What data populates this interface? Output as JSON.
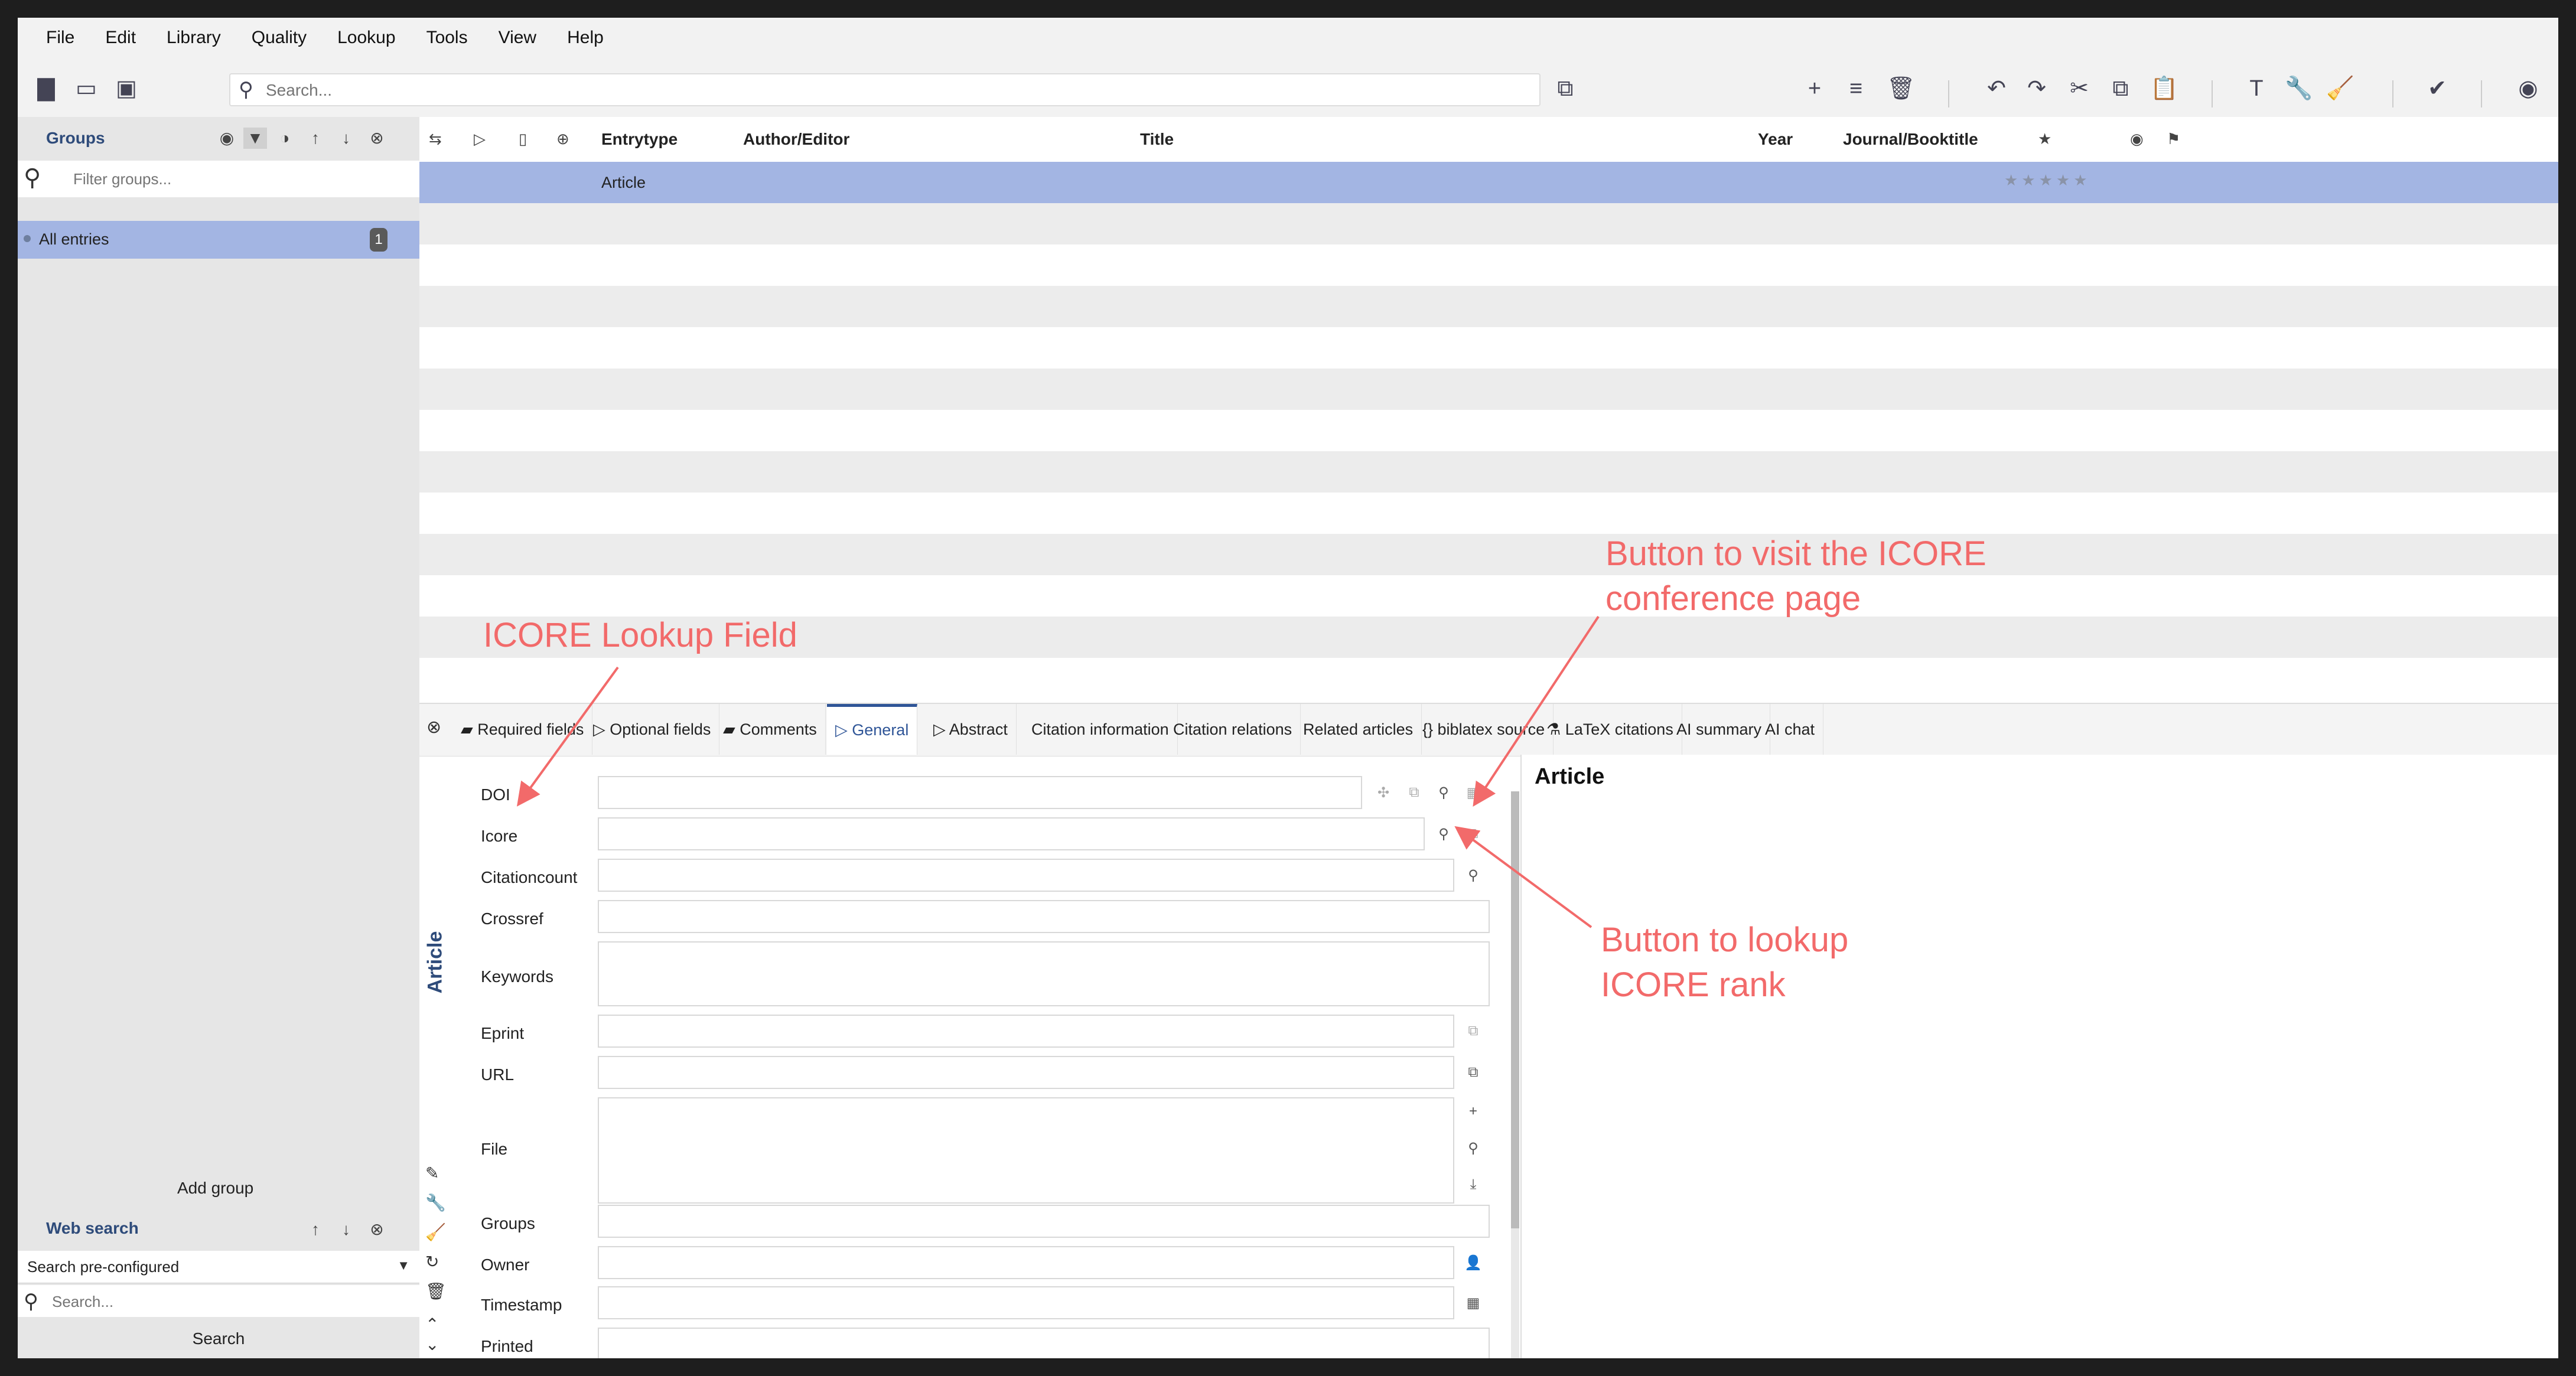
{
  "menu": [
    "File",
    "Edit",
    "Library",
    "Quality",
    "Lookup",
    "Tools",
    "View",
    "Help"
  ],
  "search": {
    "placeholder": "Search..."
  },
  "groups": {
    "title": "Groups",
    "filter_placeholder": "Filter groups...",
    "all_entries": "All entries",
    "all_entries_count": "1",
    "add_group": "Add group"
  },
  "web_search": {
    "title": "Web search",
    "selected": "Search pre-configured",
    "placeholder": "Search...",
    "button": "Search"
  },
  "table": {
    "columns": [
      "Entrytype",
      "Author/Editor",
      "Title",
      "Year",
      "Journal/Booktitle"
    ],
    "rows": [
      {
        "entrytype": "Article",
        "rating": "★★★★★"
      }
    ]
  },
  "editor": {
    "tabs": [
      "Required fields",
      "Optional fields",
      "Comments",
      "General",
      "Abstract",
      "Citation information",
      "Citation relations",
      "Related articles",
      "{} biblatex source",
      "LaTeX citations",
      "AI summary",
      "AI chat"
    ],
    "active_tab": "General",
    "entry_type_vertical": "Article",
    "fields": [
      "DOI",
      "Icore",
      "Citationcount",
      "Crossref",
      "Keywords",
      "Eprint",
      "URL",
      "File",
      "Groups",
      "Owner",
      "Timestamp",
      "Printed"
    ],
    "preview_title": "Article"
  },
  "annotations": {
    "icore_field": "ICORE Lookup Field",
    "visit_line1": "Button to visit the ICORE",
    "visit_line2": "conference page",
    "lookup_line1": "Button to lookup",
    "lookup_line2": "ICORE rank"
  },
  "colors": {
    "selection": "#a3b5e3",
    "accent": "#2f5597",
    "annotation": "#f26a6a"
  }
}
